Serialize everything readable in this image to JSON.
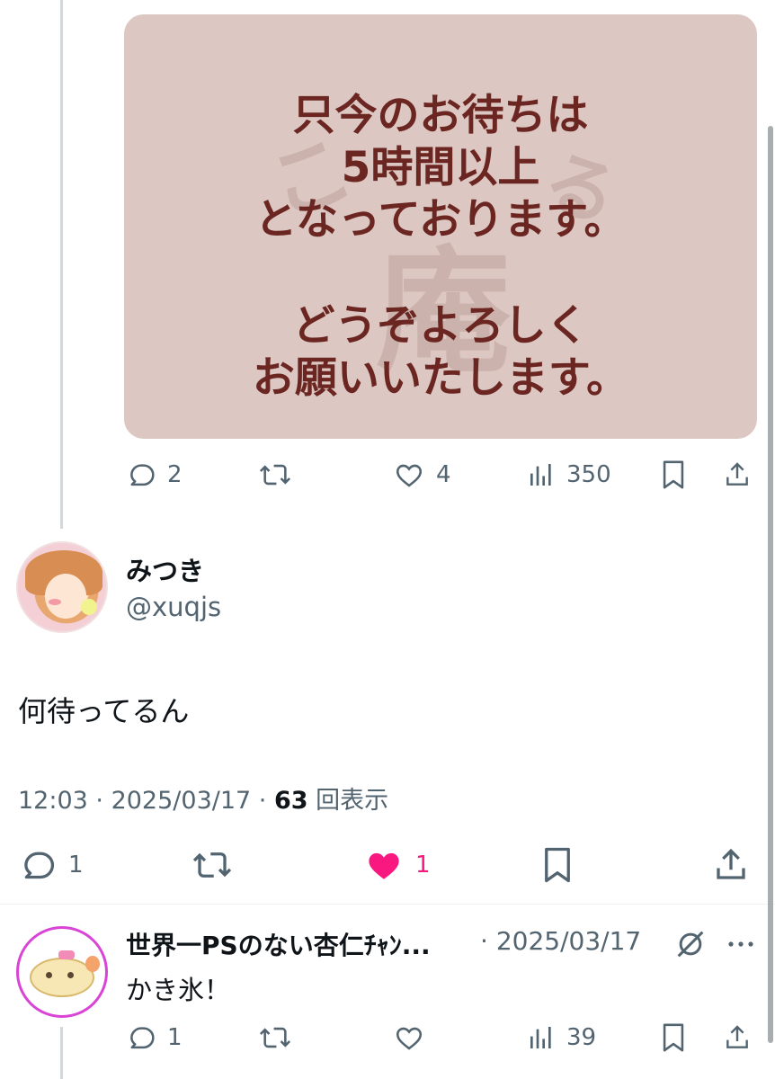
{
  "quoted_image": {
    "lines": [
      "只今のお待ちは",
      "5時間以上",
      "となっております。",
      "どうぞよろしく",
      "お願いいたします。"
    ]
  },
  "quote_actions": {
    "reply_count": "2",
    "like_count": "4",
    "views_count": "350"
  },
  "tweet": {
    "display_name": "みつき",
    "handle": "@xuqjs",
    "text": "何待ってるん",
    "time": "12:03",
    "date": "2025/03/17",
    "views_count": "63",
    "views_label": "回表示",
    "reply_count": "1",
    "like_count": "1",
    "liked": true
  },
  "reply": {
    "display_name": "世界一PSのない杏仁ﾁｬﾝ...",
    "date_sep": "·",
    "date": "2025/03/17",
    "text": "かき氷！",
    "reply_count": "1",
    "views_count": "39"
  },
  "colors": {
    "like_active": "#f91880",
    "text_primary": "#0f1419",
    "text_secondary": "#536471",
    "sign_text": "#6b2622",
    "sign_background": "#dcc7c2"
  }
}
